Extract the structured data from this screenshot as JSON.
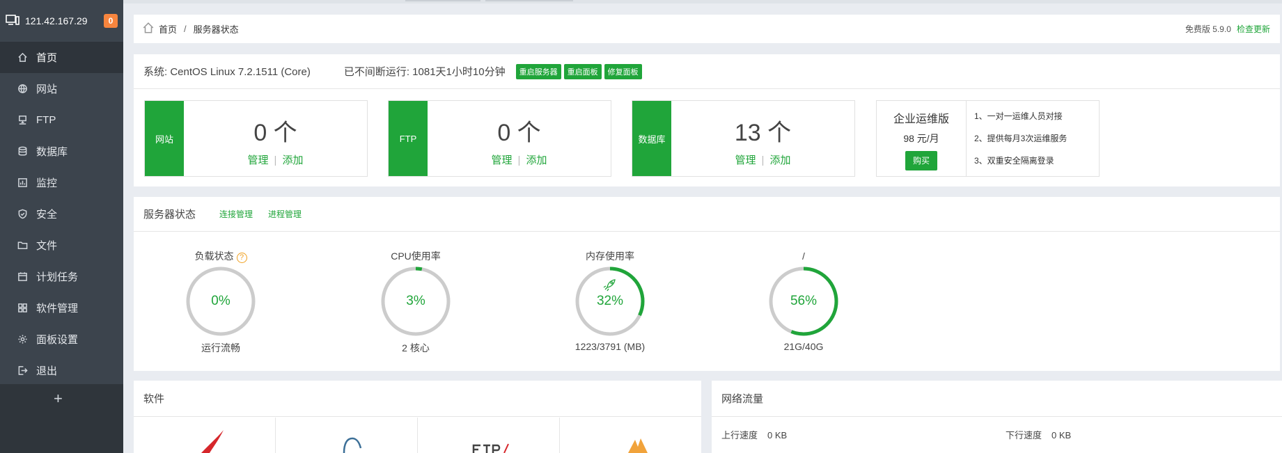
{
  "server": {
    "ip": "121.42.167.29",
    "notifications": "0"
  },
  "sidebar": {
    "items": [
      {
        "label": "首页",
        "icon": "home-icon"
      },
      {
        "label": "网站",
        "icon": "globe-icon"
      },
      {
        "label": "FTP",
        "icon": "ftp-icon"
      },
      {
        "label": "数据库",
        "icon": "database-icon"
      },
      {
        "label": "监控",
        "icon": "monitor-icon"
      },
      {
        "label": "安全",
        "icon": "shield-icon"
      },
      {
        "label": "文件",
        "icon": "folder-icon"
      },
      {
        "label": "计划任务",
        "icon": "calendar-icon"
      },
      {
        "label": "软件管理",
        "icon": "apps-icon"
      },
      {
        "label": "面板设置",
        "icon": "gear-icon"
      },
      {
        "label": "退出",
        "icon": "logout-icon"
      }
    ],
    "add_label": "+"
  },
  "breadcrumb": {
    "home": "首页",
    "separator": "/",
    "current": "服务器状态",
    "version": "免费版 5.9.0",
    "update_link": "检查更新"
  },
  "overview": {
    "system": "系统: CentOS Linux 7.2.1511 (Core)",
    "uptime": "已不间断运行: 1081天1小时10分钟",
    "buttons": {
      "restart_server": "重启服务器",
      "restart_panel": "重启面板",
      "repair_panel": "修复面板"
    },
    "stats": [
      {
        "tag": "网站",
        "count": "0 个",
        "manage": "管理",
        "add": "添加",
        "divider": "|"
      },
      {
        "tag": "FTP",
        "count": "0 个",
        "manage": "管理",
        "add": "添加",
        "divider": "|"
      },
      {
        "tag": "数据库",
        "count": "13 个",
        "manage": "管理",
        "add": "添加",
        "divider": "|"
      }
    ],
    "promo": {
      "title": "企业运维版",
      "price": "98 元/月",
      "buy": "购买",
      "features": [
        "1、一对一运维人员对接",
        "2、提供每月3次运维服务",
        "3、双重安全隔离登录"
      ]
    }
  },
  "status": {
    "title": "服务器状态",
    "link_connections": "连接管理",
    "link_processes": "进程管理",
    "help_glyph": "?",
    "gauges": [
      {
        "title": "负载状态",
        "value": "0%",
        "percent": 0,
        "caption": "运行流畅",
        "has_help": true
      },
      {
        "title": "CPU使用率",
        "value": "3%",
        "percent": 3,
        "caption": "2 核心"
      },
      {
        "title": "内存使用率",
        "value": "32%",
        "percent": 32,
        "caption": "1223/3791 (MB)"
      },
      {
        "title": "/",
        "value": "56%",
        "percent": 56,
        "caption": "21G/40G"
      }
    ]
  },
  "software": {
    "title": "软件"
  },
  "network": {
    "title": "网络流量",
    "upload_label": "上行速度",
    "upload_value": "0 KB",
    "download_label": "下行速度",
    "download_value": "0 KB"
  },
  "colors": {
    "accent": "#20a53a",
    "sidebar": "#3c444d",
    "badge": "#f7853e",
    "ring_track": "#cccccc"
  }
}
